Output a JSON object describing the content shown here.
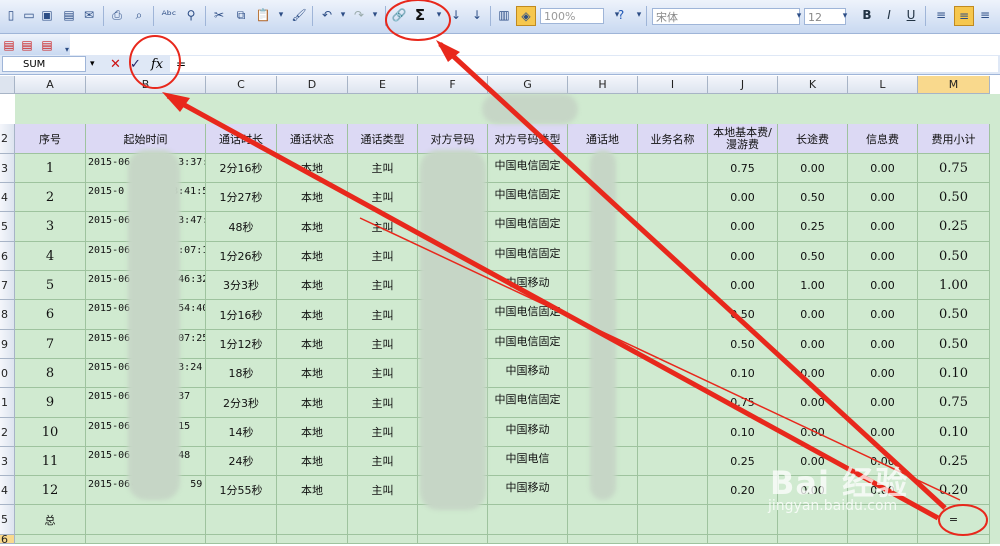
{
  "toolbar": {
    "zoom": "100%",
    "font_name": "宋体",
    "font_size": "12",
    "bold": "B",
    "italic": "I",
    "underline": "U",
    "autosum": "Σ"
  },
  "formula_bar": {
    "name_box": "SUM",
    "cancel": "✕",
    "enter": "✓",
    "fx": "fx",
    "formula": "="
  },
  "columns": [
    "A",
    "B",
    "C",
    "D",
    "E",
    "F",
    "G",
    "H",
    "I",
    "J",
    "K",
    "L",
    "M"
  ],
  "rows": [
    "2",
    "3",
    "4",
    "5",
    "6",
    "7",
    "8",
    "9",
    "0",
    "1",
    "2",
    "3",
    "4",
    "5",
    "6"
  ],
  "table": {
    "headers": [
      "序号",
      "起始时间",
      "通话时长",
      "通话状态",
      "通话类型",
      "对方号码",
      "对方号码类型",
      "通话地",
      "业务名称",
      "本地基本费/漫游费",
      "长途费",
      "信息费",
      "费用小计"
    ],
    "rows": [
      {
        "no": "1",
        "time": "2015-06",
        "time_tail": "3:37:18",
        "duration": "2分16秒",
        "status": "本地",
        "type": "主叫",
        "num_type": "中国电信固定",
        "local": "0.75",
        "long": "0.00",
        "info": "0.00",
        "subtotal": "0.75"
      },
      {
        "no": "2",
        "time": "2015-0",
        "time_tail": "3:41:57",
        "duration": "1分27秒",
        "status": "本地",
        "type": "主叫",
        "num_type": "中国电信固定",
        "local": "0.00",
        "long": "0.50",
        "info": "0.00",
        "subtotal": "0.50"
      },
      {
        "no": "3",
        "time": "2015-06",
        "time_tail": "3:47:43",
        "duration": "48秒",
        "status": "本地",
        "type": "主叫",
        "num_type": "中国电信固定",
        "local": "0.00",
        "long": "0.25",
        "info": "0.00",
        "subtotal": "0.25"
      },
      {
        "no": "4",
        "time": "2015-06",
        "time_tail": ":07:10",
        "duration": "1分26秒",
        "status": "本地",
        "type": "主叫",
        "num_type": "中国电信固定",
        "local": "0.00",
        "long": "0.50",
        "info": "0.00",
        "subtotal": "0.50"
      },
      {
        "no": "5",
        "time": "2015-06",
        "time_tail": "46:32",
        "duration": "3分3秒",
        "status": "本地",
        "type": "主叫",
        "num_type": "中国移动",
        "local": "0.00",
        "long": "1.00",
        "info": "0.00",
        "subtotal": "1.00"
      },
      {
        "no": "6",
        "time": "2015-06",
        "time_tail": "54:40",
        "duration": "1分16秒",
        "status": "本地",
        "type": "主叫",
        "num_type": "中国电信固定",
        "local": "0.50",
        "long": "0.00",
        "info": "0.00",
        "subtotal": "0.50"
      },
      {
        "no": "7",
        "time": "2015-06",
        "time_tail": "07:25",
        "duration": "1分12秒",
        "status": "本地",
        "type": "主叫",
        "num_type": "中国电信固定",
        "local": "0.50",
        "long": "0.00",
        "info": "0.00",
        "subtotal": "0.50"
      },
      {
        "no": "8",
        "time": "2015-06",
        "time_tail": "3:24",
        "duration": "18秒",
        "status": "本地",
        "type": "主叫",
        "num_type": "中国移动",
        "local": "0.10",
        "long": "0.00",
        "info": "0.00",
        "subtotal": "0.10"
      },
      {
        "no": "9",
        "time": "2015-06",
        "time_tail": "37",
        "duration": "2分3秒",
        "status": "本地",
        "type": "主叫",
        "num_type": "中国电信固定",
        "local": "0.75",
        "long": "0.00",
        "info": "0.00",
        "subtotal": "0.75"
      },
      {
        "no": "10",
        "time": "2015-06",
        "time_tail": "15",
        "duration": "14秒",
        "status": "本地",
        "type": "主叫",
        "num_type": "中国移动",
        "local": "0.10",
        "long": "0.00",
        "info": "0.00",
        "subtotal": "0.10"
      },
      {
        "no": "11",
        "time": "2015-06",
        "time_tail": "48",
        "duration": "24秒",
        "status": "本地",
        "type": "主叫",
        "num_type": "中国电信",
        "local": "0.25",
        "long": "0.00",
        "info": "0.00",
        "subtotal": "0.25"
      },
      {
        "no": "12",
        "time": "2015-06-0",
        "time_tail": "59",
        "duration": "1分55秒",
        "status": "本地",
        "type": "主叫",
        "num_type": "中国移动",
        "local": "0.20",
        "long": "0.00",
        "info": "0.00",
        "subtotal": "0.20"
      }
    ],
    "total_label": "总",
    "total_cell": "="
  },
  "watermark": {
    "main": "Bai 经验",
    "sub": "jingyan.baidu.com"
  }
}
